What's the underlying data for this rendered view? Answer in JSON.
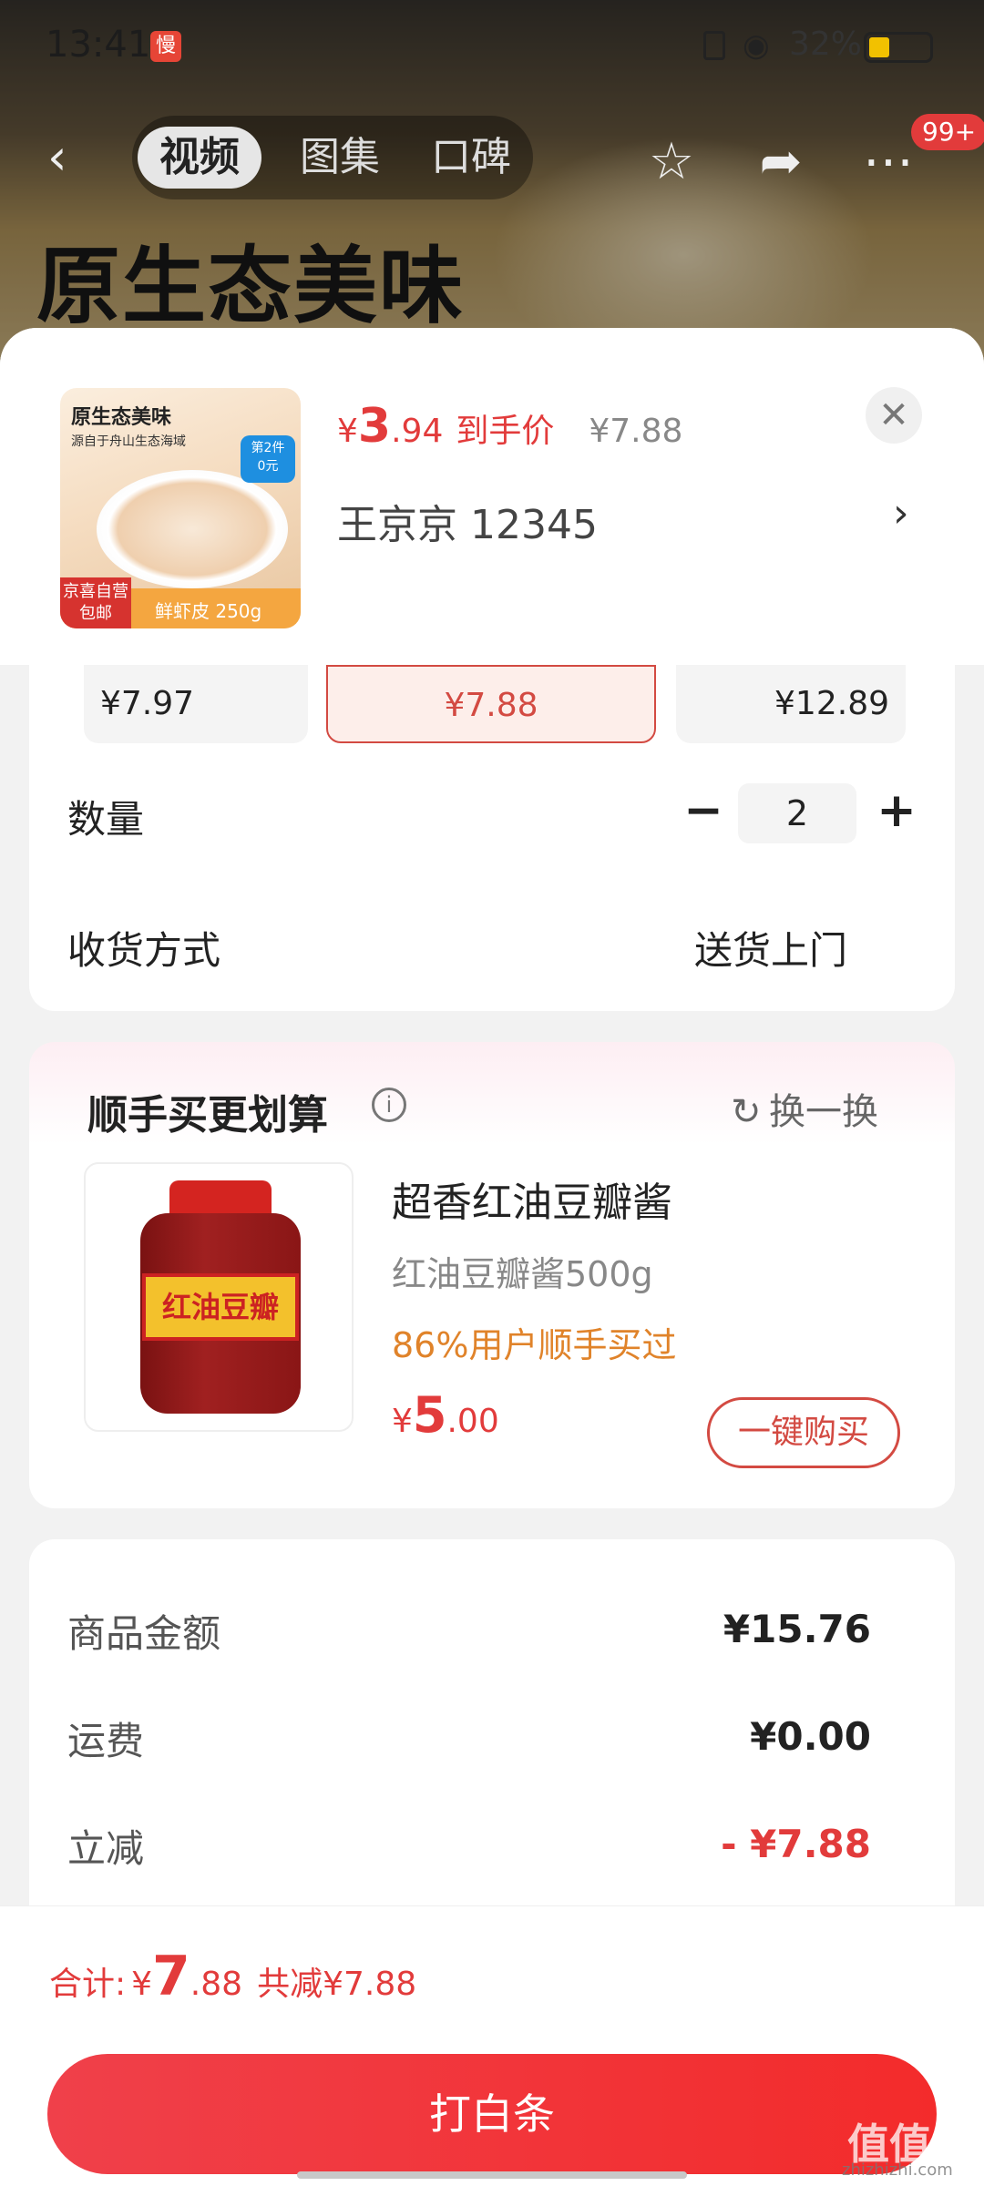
{
  "status": {
    "time": "13:41",
    "app_badge": "慢",
    "battery": "32%",
    "battery_level": 0.32
  },
  "nav": {
    "tabs": [
      "视频",
      "图集",
      "口碑"
    ],
    "active_tab": "视频",
    "notif_count": "99+"
  },
  "hero_text": "原生态美味",
  "product": {
    "img_title": "原生态美味",
    "img_subtitle": "源自于舟山生态海域",
    "img_tag": "第2件\n0元",
    "img_badge": "京喜自营\n包邮",
    "img_spec": "鲜虾皮 250g",
    "price_currency": "¥",
    "price_int": "3",
    "price_dec": ".94",
    "price_label": "到手价",
    "price_original": "¥7.88",
    "address": "王京京  12345"
  },
  "options": {
    "prices": [
      "¥7.97",
      "¥7.88",
      "¥12.89"
    ],
    "selected_index": 1,
    "qty_label": "数量",
    "qty_value": "2",
    "minus": "−",
    "plus": "+",
    "ship_label": "收货方式",
    "ship_value": "送货上门"
  },
  "upsell": {
    "title": "顺手买更划算",
    "refresh_label": "换一换",
    "jar_label": "红油豆瓣",
    "name": "超香红油豆瓣酱",
    "spec": "红油豆瓣酱500g",
    "percent_text": "86%用户顺手买过",
    "price_currency": "¥",
    "price_int": "5",
    "price_dec": ".00",
    "buy_label": "一键购买"
  },
  "summary": {
    "rows": [
      {
        "label": "商品金额",
        "value": "¥15.76"
      },
      {
        "label": "运费",
        "value": "¥0.00"
      },
      {
        "label": "立减",
        "value": "- ¥7.88"
      }
    ]
  },
  "bottom": {
    "total_label": "合计:",
    "total_currency": "¥",
    "total_int": "7",
    "total_dec": ".88",
    "saved": "共减¥7.88",
    "pay_label": "打白条"
  },
  "watermark": {
    "mark": "值值值",
    "site": "zhizhizhi.com"
  },
  "colors": {
    "accent_red": "#e23b3b",
    "orange_text": "#e0832a"
  }
}
